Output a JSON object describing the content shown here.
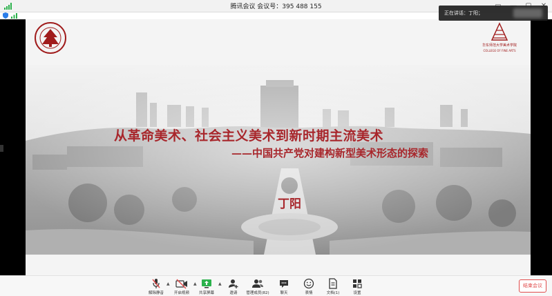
{
  "window": {
    "title": "腾讯会议  会议号：395 488 155"
  },
  "speaking": {
    "label": "正在讲话：丁阳；"
  },
  "slide": {
    "title": "从革命美术、社会主义美术到新时期主流美术",
    "subtitle": "——中国共产党对建构新型美术形态的探索",
    "author": "丁阳",
    "logo_right_line1": "华东师范大学美术学院",
    "logo_right_line2": "COLLEGE OF FINE ARTS",
    "logo_left_text": "EAST CHINA NORMAL UNIVERSITY"
  },
  "toolbar": {
    "mute": "解除静音",
    "video": "开启视频",
    "share": "共享屏幕",
    "invite": "邀请",
    "members": "管理成员(82)",
    "chat": "聊天",
    "reaction": "表情",
    "docs": "文档(1)",
    "settings": "设置",
    "end": "结束会议"
  },
  "colors": {
    "accent_red": "#a8262b",
    "end_red": "#e04b4b",
    "toolbar_bg": "#f7f7f7"
  }
}
